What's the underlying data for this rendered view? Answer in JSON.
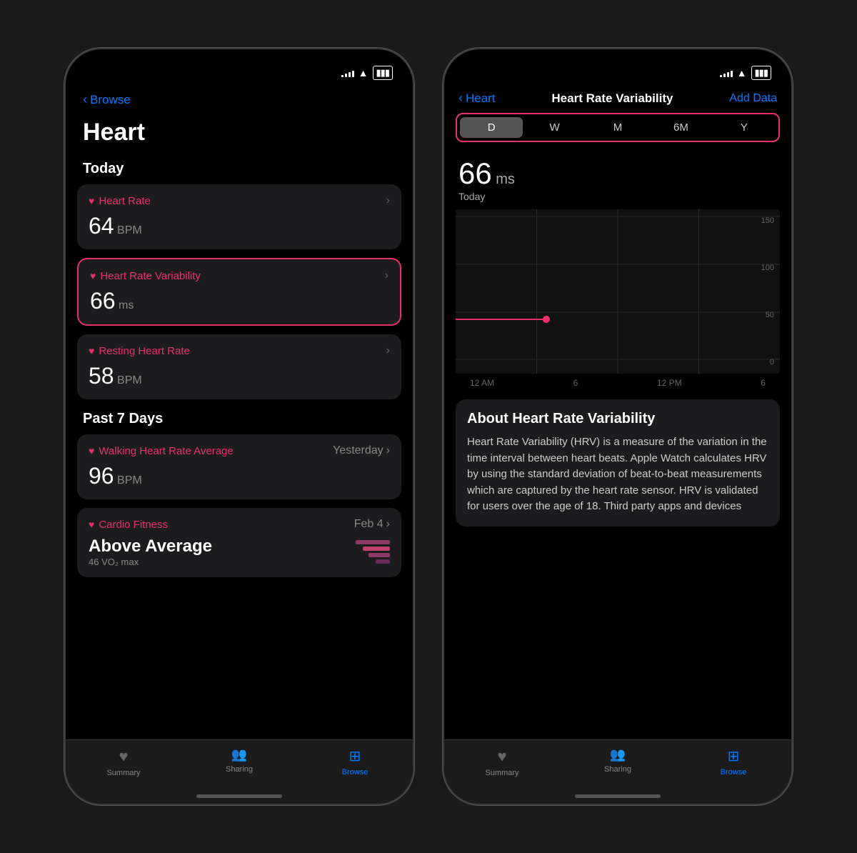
{
  "left_phone": {
    "status": {
      "signal": [
        3,
        5,
        7,
        9,
        11
      ],
      "wifi": "wifi",
      "battery": "battery"
    },
    "nav": {
      "back_label": "Browse"
    },
    "page_title": "Heart",
    "sections": [
      {
        "id": "today",
        "header": "Today",
        "cards": [
          {
            "id": "heart-rate",
            "icon": "♥",
            "title": "Heart Rate",
            "value": "64",
            "unit": "BPM",
            "highlighted": false
          },
          {
            "id": "hrv",
            "icon": "♥",
            "title": "Heart Rate Variability",
            "value": "66",
            "unit": "ms",
            "highlighted": true
          },
          {
            "id": "resting",
            "icon": "♥",
            "title": "Resting Heart Rate",
            "value": "58",
            "unit": "BPM",
            "highlighted": false
          }
        ]
      },
      {
        "id": "past7",
        "header": "Past 7 Days",
        "cards": [
          {
            "id": "walking",
            "icon": "♥",
            "title": "Walking Heart Rate Average",
            "date": "Yesterday",
            "value": "96",
            "unit": "BPM",
            "highlighted": false
          },
          {
            "id": "cardio",
            "icon": "♥",
            "title": "Cardio Fitness",
            "date": "Feb 4",
            "value_bold": "Above Average",
            "sub": "46 VO₂ max",
            "highlighted": false
          }
        ]
      }
    ],
    "tab_bar": {
      "items": [
        {
          "id": "summary",
          "icon": "♥",
          "label": "Summary",
          "active": false
        },
        {
          "id": "sharing",
          "icon": "👥",
          "label": "Sharing",
          "active": false
        },
        {
          "id": "browse",
          "icon": "⊞",
          "label": "Browse",
          "active": true
        }
      ]
    }
  },
  "right_phone": {
    "nav": {
      "back_label": "Heart",
      "title": "Heart Rate Variability",
      "right_btn": "Add Data"
    },
    "time_filters": [
      "D",
      "W",
      "M",
      "6M",
      "Y"
    ],
    "active_filter": "D",
    "hrv_value": "66",
    "hrv_unit": "ms",
    "hrv_label": "Today",
    "chart": {
      "y_labels": [
        "150",
        "100",
        "50",
        "0"
      ],
      "x_labels": [
        "12 AM",
        "6",
        "12 PM",
        "6"
      ],
      "data_point": {
        "x_pct": 28,
        "y_pct": 67
      }
    },
    "about": {
      "title": "About Heart Rate Variability",
      "text": "Heart Rate Variability (HRV) is a measure of the variation in the time interval between heart beats. Apple Watch calculates HRV by using the standard deviation of beat-to-beat measurements which are captured by the heart rate sensor. HRV is validated for users over the age of 18. Third party apps and devices"
    },
    "tab_bar": {
      "items": [
        {
          "id": "summary",
          "icon": "♥",
          "label": "Summary",
          "active": false
        },
        {
          "id": "sharing",
          "icon": "👥",
          "label": "Sharing",
          "active": false
        },
        {
          "id": "browse",
          "icon": "⊞",
          "label": "Browse",
          "active": true
        }
      ]
    }
  },
  "colors": {
    "accent_red": "#E8316A",
    "accent_blue": "#007AFF",
    "bg_card": "#1c1c1e",
    "text_primary": "#ffffff",
    "text_secondary": "#888888"
  }
}
